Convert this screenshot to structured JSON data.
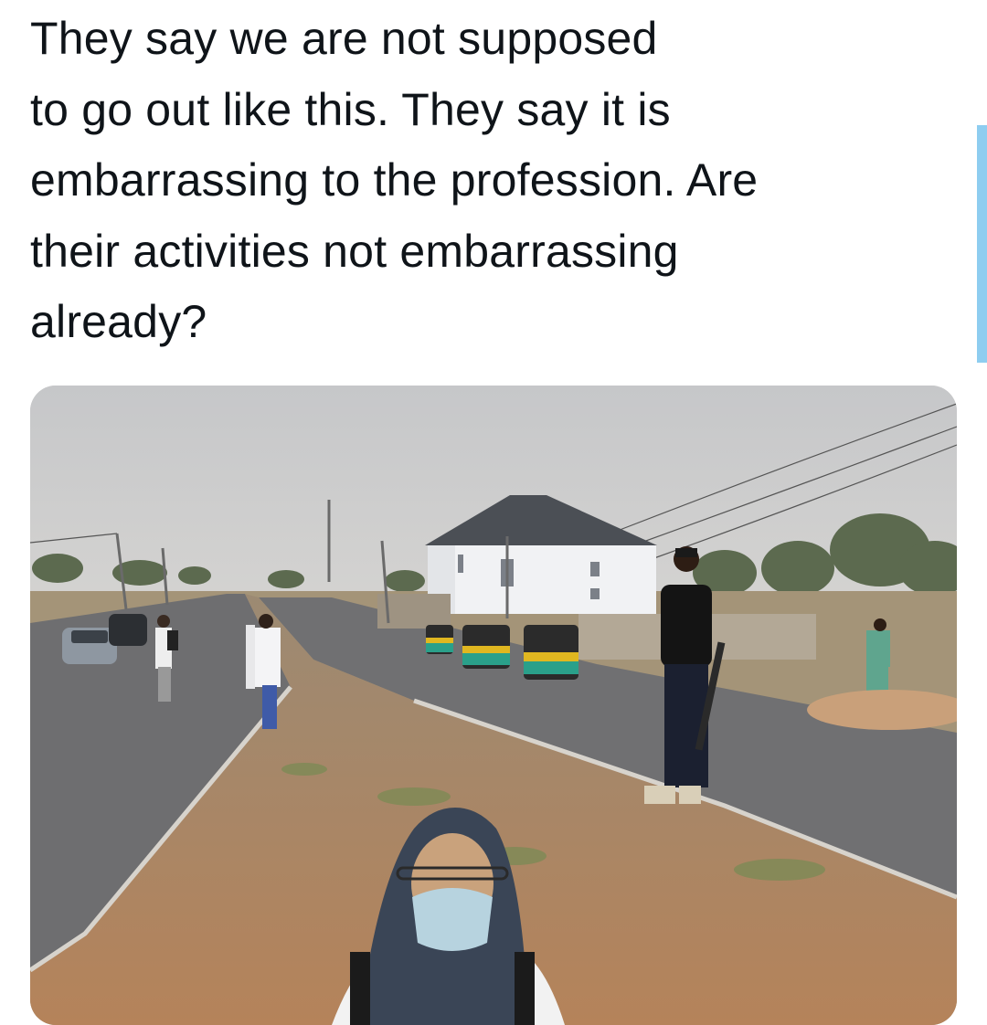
{
  "tweet": {
    "text": "They say we are not supposed\nto go out like this. They say it is\nembarrassing to the profession. Are\ntheir activities not embarrassing\nalready?"
  },
  "colors": {
    "text": "#0f1419",
    "scroll_indicator": "#8ecdf0",
    "sky": "#c9cacb",
    "road": "#6f6f71",
    "ground": "#b58a63"
  }
}
